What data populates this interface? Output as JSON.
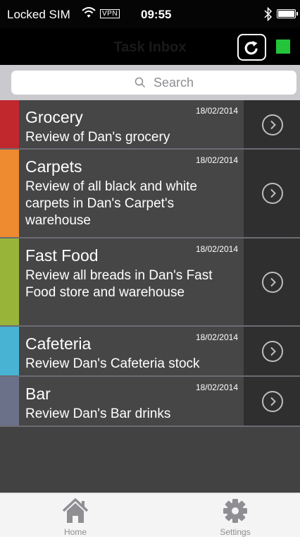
{
  "status_bar": {
    "carrier": "Locked SIM",
    "vpn": "VPN",
    "time": "09:55"
  },
  "nav": {
    "title": "Task Inbox",
    "refresh_icon": "refresh-icon",
    "status_color": "#23c43a"
  },
  "search": {
    "placeholder": "Search"
  },
  "tasks": [
    {
      "name": "Grocery",
      "date": "18/02/2014",
      "description": "Review of Dan's grocery",
      "color": "#c0282e"
    },
    {
      "name": "Carpets",
      "date": "18/02/2014",
      "description": "Review of all black and white carpets in Dan's Carpet's warehouse",
      "color": "#ee8a2f"
    },
    {
      "name": "Fast Food",
      "date": "18/02/2014",
      "description": "Review all breads in Dan's Fast Food store and warehouse",
      "color": "#98b53a"
    },
    {
      "name": "Cafeteria",
      "date": "18/02/2014",
      "description": "Review Dan's Cafeteria stock",
      "color": "#49b3d4"
    },
    {
      "name": "Bar",
      "date": "18/02/2014",
      "description": "Review Dan's Bar drinks",
      "color": "#6b7189"
    }
  ],
  "tab_bar": {
    "tabs": [
      {
        "label": "Home",
        "icon": "home-icon"
      },
      {
        "label": "Settings",
        "icon": "gear-icon"
      }
    ]
  }
}
